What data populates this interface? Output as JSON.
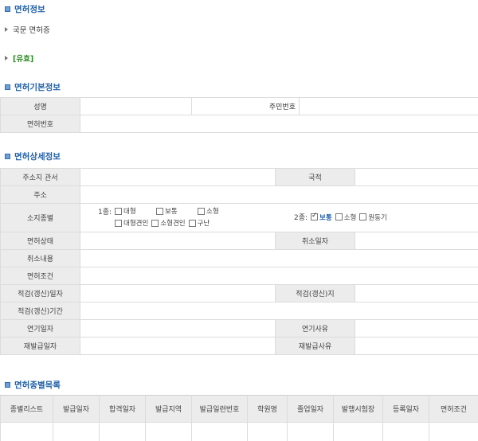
{
  "sections": {
    "license_info": "면허정보",
    "basic_info": "면허기본정보",
    "detail_info": "면허상세정보",
    "type_list": "면허종별목록"
  },
  "license_info": {
    "kind": "국문 면허증",
    "status": "[유효]"
  },
  "basic": {
    "name_label": "성명",
    "id_label": "주민번호",
    "license_no_label": "면허번호"
  },
  "detail": {
    "office_label": "주소지 관서",
    "nationality_label": "국적",
    "address_label": "주소",
    "class_label": "소지종별",
    "class1_label": "1종:",
    "class1_options": [
      "대형",
      "보통",
      "소형",
      "대형견인",
      "소형견인",
      "구난"
    ],
    "class2_label": "2종:",
    "class2_options": [
      "보통",
      "소형",
      "원동기"
    ],
    "class2_checked": "보통",
    "state_label": "면허상태",
    "cancel_date_label": "취소일자",
    "cancel_content_label": "취소내용",
    "condition_label": "면허조건",
    "renew_date_label": "적검(갱신)일자",
    "renew_place_label": "적검(갱신)지",
    "renew_period_label": "적검(갱신)기간",
    "postpone_date_label": "연기일자",
    "postpone_reason_label": "연기사유",
    "reissue_date_label": "재발급일자",
    "reissue_reason_label": "재발급사유"
  },
  "type_list": {
    "columns": [
      "종별리스트",
      "발급일자",
      "합격일자",
      "발급지역",
      "발급일련번호",
      "학원명",
      "졸업일자",
      "발행시험장",
      "등록일자",
      "면허조건"
    ]
  }
}
